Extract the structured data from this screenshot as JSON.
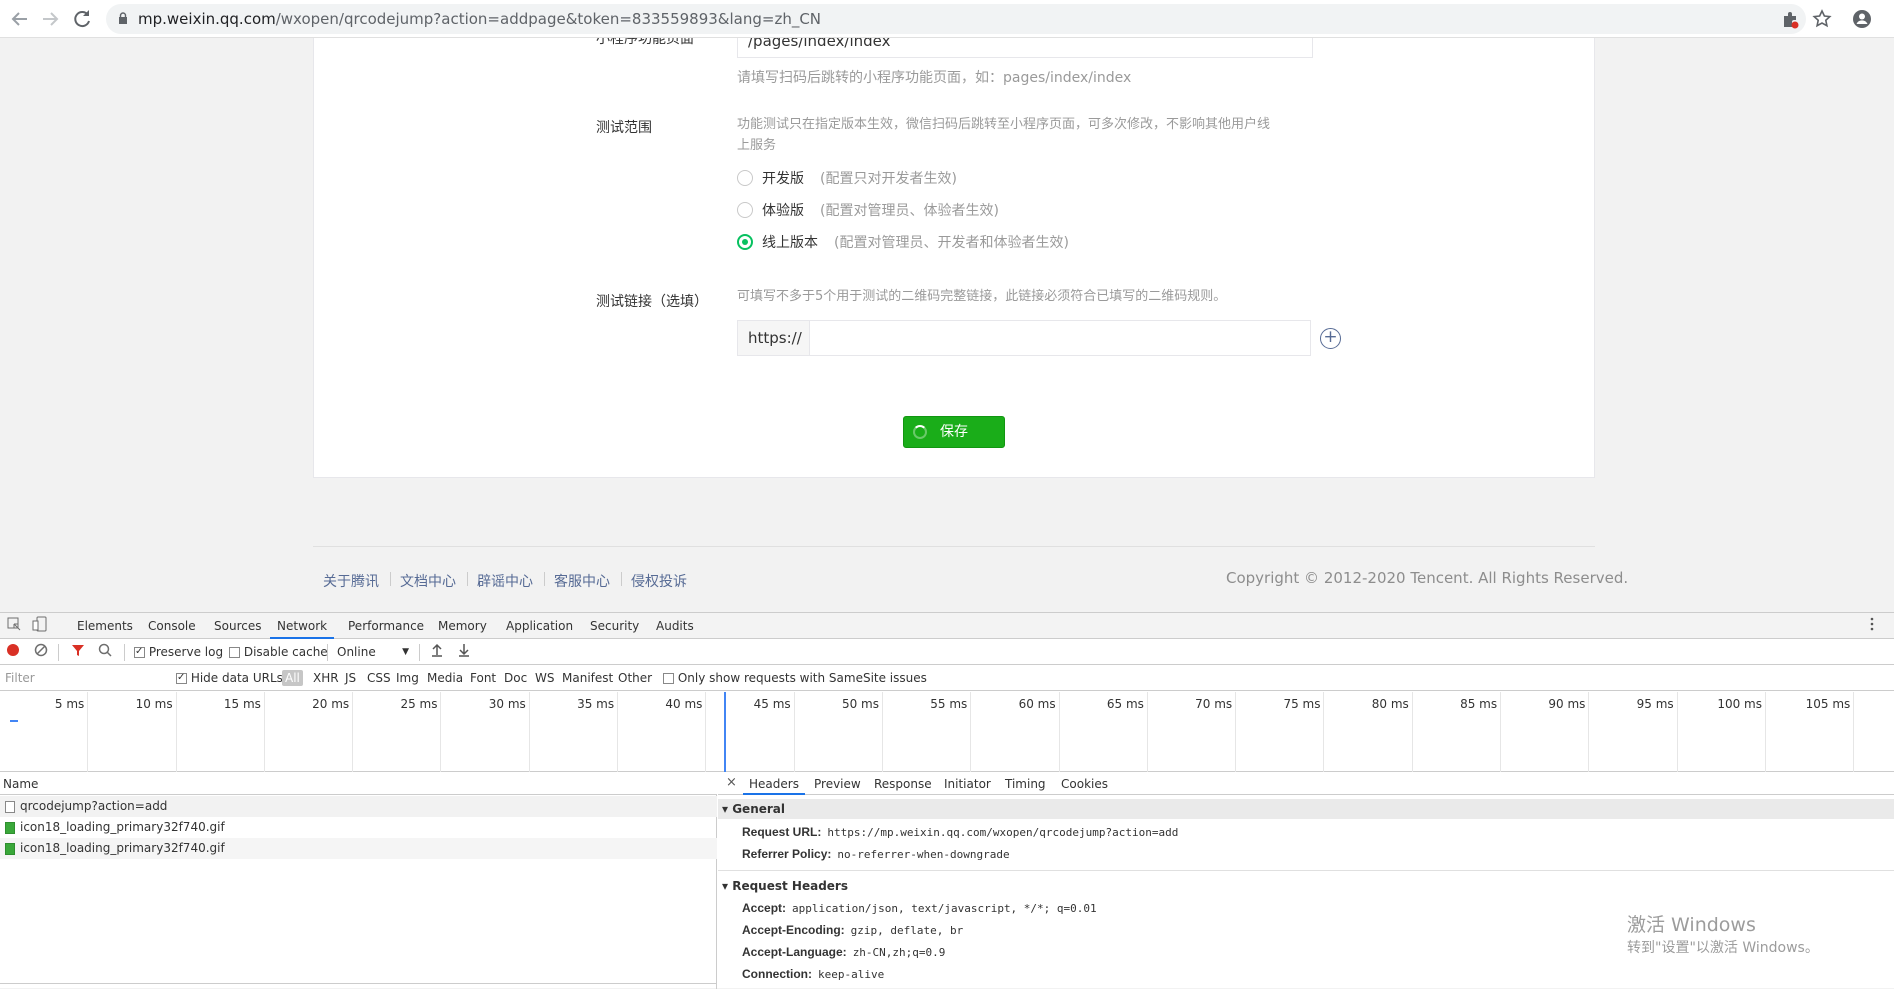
{
  "browser": {
    "url_host": "mp.weixin.qq.com",
    "url_rest": "/wxopen/qrcodejump?action=addpage&token=833559893&lang=zh_CN",
    "icons": [
      "back-icon",
      "forward-icon",
      "reload-icon",
      "lock-icon",
      "extension-icon",
      "star-icon",
      "profile-icon"
    ]
  },
  "form": {
    "page_label": "小程序功能页面",
    "page_value": "/pages/index/index",
    "page_hint": "请填写扫码后跳转的小程序功能页面，如：pages/index/index",
    "scope_label": "测试范围",
    "scope_hint_line1": "功能测试只在指定版本生效，微信扫码后跳转至小程序页面，可多次修改，不影响其他用户线",
    "scope_hint_line2": "上服务",
    "radios": [
      {
        "label": "开发版",
        "note": "(配置只对开发者生效)",
        "selected": false
      },
      {
        "label": "体验版",
        "note": "(配置对管理员、体验者生效)",
        "selected": false
      },
      {
        "label": "线上版本",
        "note": "(配置对管理员、开发者和体验者生效)",
        "selected": true
      }
    ],
    "link_label": "测试链接（选填）",
    "link_hint": "可填写不多于5个用于测试的二维码完整链接，此链接必须符合已填写的二维码规则。",
    "link_prefix": "https://",
    "link_value": "",
    "add_symbol": "+",
    "save_label": "保存",
    "accent_color": "#1aad19"
  },
  "footer": {
    "links": [
      "关于腾讯",
      "文档中心",
      "辟谣中心",
      "客服中心",
      "侵权投诉"
    ],
    "copyright": "Copyright © 2012-2020 Tencent. All Rights Reserved."
  },
  "devtools": {
    "tabs": [
      "Elements",
      "Console",
      "Sources",
      "Network",
      "Performance",
      "Memory",
      "Application",
      "Security",
      "Audits"
    ],
    "active_tab": "Network",
    "toolbar": {
      "preserve_log": "Preserve log",
      "disable_cache": "Disable cache",
      "throttle": "Online"
    },
    "filter": {
      "placeholder": "Filter",
      "hide_data_urls": "Hide data URLs",
      "types": [
        "All",
        "XHR",
        "JS",
        "CSS",
        "Img",
        "Media",
        "Font",
        "Doc",
        "WS",
        "Manifest",
        "Other"
      ],
      "samesite": "Only show requests with SameSite issues"
    },
    "timeline_ticks": [
      "5 ms",
      "10 ms",
      "15 ms",
      "20 ms",
      "25 ms",
      "30 ms",
      "35 ms",
      "40 ms",
      "45 ms",
      "50 ms",
      "55 ms",
      "60 ms",
      "65 ms",
      "70 ms",
      "75 ms",
      "80 ms",
      "85 ms",
      "90 ms",
      "95 ms",
      "100 ms",
      "105 ms"
    ],
    "name_header": "Name",
    "requests": [
      "qrcodejump?action=add",
      "icon18_loading_primary32f740.gif",
      "icon18_loading_primary32f740.gif"
    ],
    "detail_tabs": [
      "Headers",
      "Preview",
      "Response",
      "Initiator",
      "Timing",
      "Cookies"
    ],
    "close_symbol": "×",
    "general": {
      "title": "General",
      "request_url_key": "Request URL:",
      "request_url": "https://mp.weixin.qq.com/wxopen/qrcodejump?action=add",
      "referrer_key": "Referrer Policy:",
      "referrer": "no-referrer-when-downgrade"
    },
    "request_headers": {
      "title": "Request Headers",
      "rows": [
        {
          "k": "Accept:",
          "v": "application/json, text/javascript, */*; q=0.01"
        },
        {
          "k": "Accept-Encoding:",
          "v": "gzip, deflate, br"
        },
        {
          "k": "Accept-Language:",
          "v": "zh-CN,zh;q=0.9"
        },
        {
          "k": "Connection:",
          "v": "keep-alive"
        }
      ]
    }
  },
  "watermark": {
    "line1": "激活 Windows",
    "line2": "转到\"设置\"以激活 Windows。"
  }
}
